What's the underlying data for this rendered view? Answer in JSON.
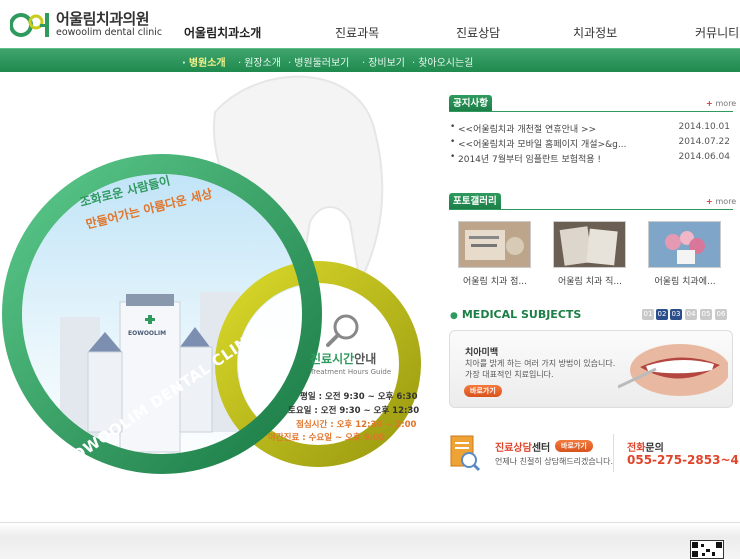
{
  "brand": {
    "name": "어울림치과의원",
    "subtitle": "eowoolim dental clinic",
    "color_green": "#2f9a5e",
    "color_orange": "#e0452b"
  },
  "gnb": [
    {
      "label": "어울림치과소개",
      "active": true
    },
    {
      "label": "진료과목",
      "active": false
    },
    {
      "label": "진료상담",
      "active": false
    },
    {
      "label": "치과정보",
      "active": false
    },
    {
      "label": "커뮤니티",
      "active": false
    }
  ],
  "subnav": [
    {
      "label": "병원소개",
      "active": true
    },
    {
      "label": "원장소개",
      "active": false
    },
    {
      "label": "병원둘러보기",
      "active": false
    },
    {
      "label": "장비보기",
      "active": false
    },
    {
      "label": "찾아오시는길",
      "active": false
    }
  ],
  "visual": {
    "slogan_line1": "조화로운 사람들이",
    "slogan_line2": "만들어가는 아름다운 세상",
    "ring_text": "EOWOOLIM DENTAL CLINIC",
    "building_sign": "EOWOOLIM",
    "hours_title_strong": "진료시간",
    "hours_title_rest": "안내",
    "hours_subtitle": "Treatment Hours Guide",
    "hours": [
      {
        "text": "평일 : 오전 9:30 ~ 오후 6:30",
        "highlight": false
      },
      {
        "text": "토요일 : 오전 9:30 ~ 오후 12:30",
        "highlight": false
      },
      {
        "text": "점심시간 : 오후 12:30 ~ 2:00",
        "highlight": true
      },
      {
        "text": "야간진료 : 수요일 ~ 오후 9:00",
        "highlight": true
      }
    ]
  },
  "notice": {
    "title": "공지사항",
    "more": "more",
    "items": [
      {
        "title": "<<어울림치과 개천절 연휴안내 >>",
        "date": "2014.10.01"
      },
      {
        "title": "<<어울림치과 모바일 홈페이지 개설>&g...",
        "date": "2014.07.22"
      },
      {
        "title": "2014년 7월부터 임플란트 보험적용 !",
        "date": "2014.06.04"
      }
    ]
  },
  "gallery": {
    "title": "포토갤러리",
    "more": "more",
    "items": [
      {
        "caption": "어울림 치과 점...",
        "icon": "dental-tools-photo"
      },
      {
        "caption": "어울림 치과 직...",
        "icon": "documents-photo"
      },
      {
        "caption": "어울림 치과에...",
        "icon": "flowers-photo"
      }
    ]
  },
  "medical": {
    "title": "MEDICAL SUBJECTS",
    "pages": [
      "01",
      "02",
      "03",
      "04",
      "05",
      "06"
    ],
    "active_pages": [
      "02",
      "03"
    ],
    "subject_name": "치아미백",
    "desc_line1": "치아를 밝게 하는 여러 가지 방법이 있습니다.",
    "desc_line2": "가장 대표적인 치료입니다.",
    "button": "바로가기"
  },
  "consult": {
    "title_accent": "진료상담",
    "title_rest": "센터",
    "button": "바로가기",
    "desc": "언제나 친절히 상담해드리겠습니다.",
    "phone_accent": "전화",
    "phone_rest": "문의",
    "phone": "055-275-2853~4"
  }
}
